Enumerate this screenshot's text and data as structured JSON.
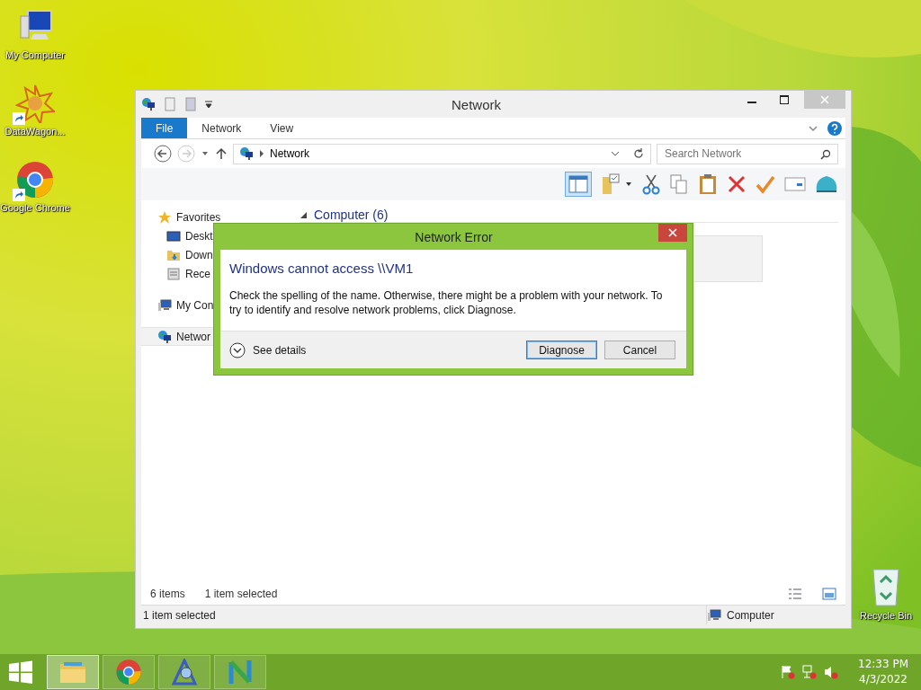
{
  "desktop_icons": [
    {
      "label": "My Computer",
      "kind": "computer"
    },
    {
      "label": "DataWagon...",
      "kind": "star",
      "shortcut": true
    },
    {
      "label": "Google Chrome",
      "kind": "chrome",
      "shortcut": true
    }
  ],
  "recycle_bin": {
    "label": "Recycle Bin"
  },
  "window": {
    "title": "Network",
    "ribbon_tabs": [
      {
        "label": "File",
        "selected": true
      },
      {
        "label": "Network",
        "selected": false
      },
      {
        "label": "View",
        "selected": false
      }
    ],
    "address": {
      "path": "Network"
    },
    "search": {
      "placeholder": "Search Network"
    },
    "sidebar": [
      {
        "label": "Favorites",
        "kind": "star",
        "selected": false,
        "children": [
          {
            "label": "Deskt",
            "kind": "desktop",
            "selected": false
          },
          {
            "label": "Down",
            "kind": "download",
            "selected": false
          },
          {
            "label": "Rece",
            "kind": "recent",
            "selected": false
          }
        ]
      },
      {
        "label": "My Con",
        "kind": "computer",
        "selected": false
      },
      {
        "label": "Networ",
        "kind": "network",
        "selected": true
      }
    ],
    "group": {
      "label": "Computer (6)",
      "expanded": true
    },
    "content_status": {
      "count": "6 items",
      "selection": "1 item selected"
    },
    "status_bar": {
      "text": "1 item selected",
      "location": "Computer"
    }
  },
  "dialog": {
    "title": "Network Error",
    "heading": "Windows cannot access \\\\VM1",
    "message": "Check the spelling of the name. Otherwise, there might be a problem with your network. To try to identify and resolve network problems, click Diagnose.",
    "details": "See details",
    "buttons": [
      {
        "label": "Diagnose",
        "selected": true
      },
      {
        "label": "Cancel",
        "selected": false
      }
    ]
  },
  "taskbar": {
    "items": [
      {
        "kind": "explorer",
        "selected": true
      },
      {
        "kind": "chrome",
        "selected": false
      },
      {
        "kind": "app-a",
        "selected": false
      },
      {
        "kind": "app-n",
        "selected": false
      }
    ],
    "time": "12:33 PM",
    "date": "4/3/2022"
  }
}
